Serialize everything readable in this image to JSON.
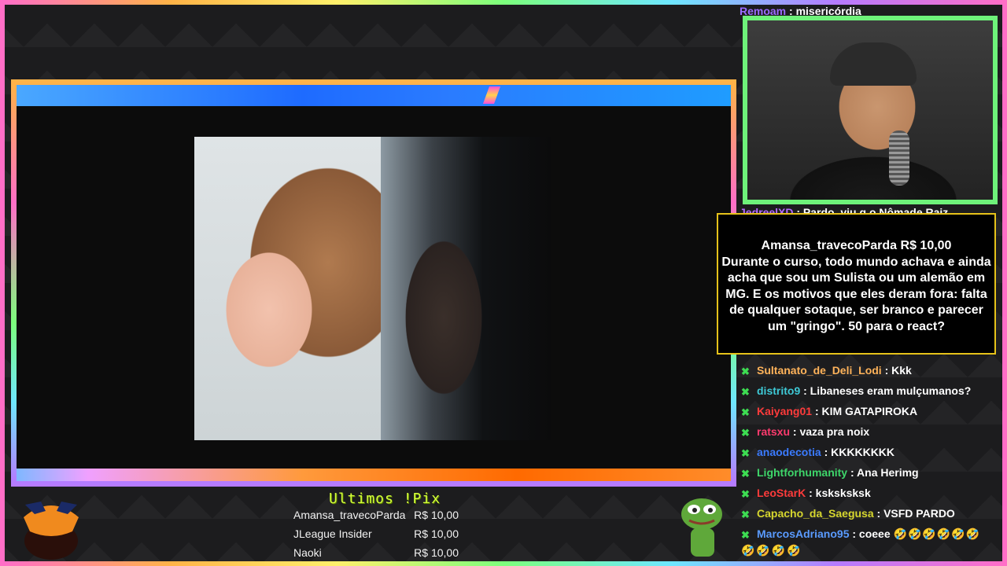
{
  "chat_top": {
    "user": "Remoam",
    "text": ": misericórdia"
  },
  "chat_partial": {
    "user": "JedreelXD",
    "text": ": Pardo, viu q o Nômade Raiz"
  },
  "alert": {
    "header": "Amansa_travecoParda R$ 10,00",
    "body": "Durante o curso, todo mundo achava e ainda acha que sou um Sulista ou um alemão em MG. E os motivos que eles deram fora: falta de qualquer sotaque, ser branco e parecer um \"gringo\". 50 para o react?"
  },
  "chat": [
    {
      "user": "Sultanato_de_Deli_Lodi",
      "color": "#ffb35a",
      "text": ": Kkk"
    },
    {
      "user": "distrito9",
      "color": "#3ec9d6",
      "text": ": Libaneses eram mulçumanos?"
    },
    {
      "user": "Kaiyang01",
      "color": "#ff3b3b",
      "text": ": KIM GATAPIROKA"
    },
    {
      "user": "ratsxu",
      "color": "#ff3b6e",
      "text": ": vaza pra noix"
    },
    {
      "user": "anaodecotia",
      "color": "#3b7bff",
      "text": ": KKKKKKKK"
    },
    {
      "user": "Lightforhumanity",
      "color": "#3ed66a",
      "text": ": Ana Herimg"
    },
    {
      "user": "LeoStarK",
      "color": "#ff3b3b",
      "text": ": ksksksksk"
    },
    {
      "user": "Capacho_da_Saegusa",
      "color": "#d6d62e",
      "text": ": VSFD PARDO"
    },
    {
      "user": "MarcosAdriano95",
      "color": "#5a9bff",
      "text": ": coeee",
      "emotes": "🤣🤣🤣🤣🤣🤣"
    }
  ],
  "chat_wrap_emotes": "🤣🤣🤣🤣",
  "pix": {
    "title": "Ultimos !Pix",
    "rows": [
      {
        "name": "Amansa_travecoParda",
        "amount": "R$ 10,00"
      },
      {
        "name": "JLeague Insider",
        "amount": "R$ 10,00"
      },
      {
        "name": "Naoki",
        "amount": "R$ 10,00"
      }
    ]
  },
  "colors": {
    "accent_green": "#6ef27a",
    "alert_border": "#e6c21a",
    "pix_title": "#d4ff3a"
  }
}
